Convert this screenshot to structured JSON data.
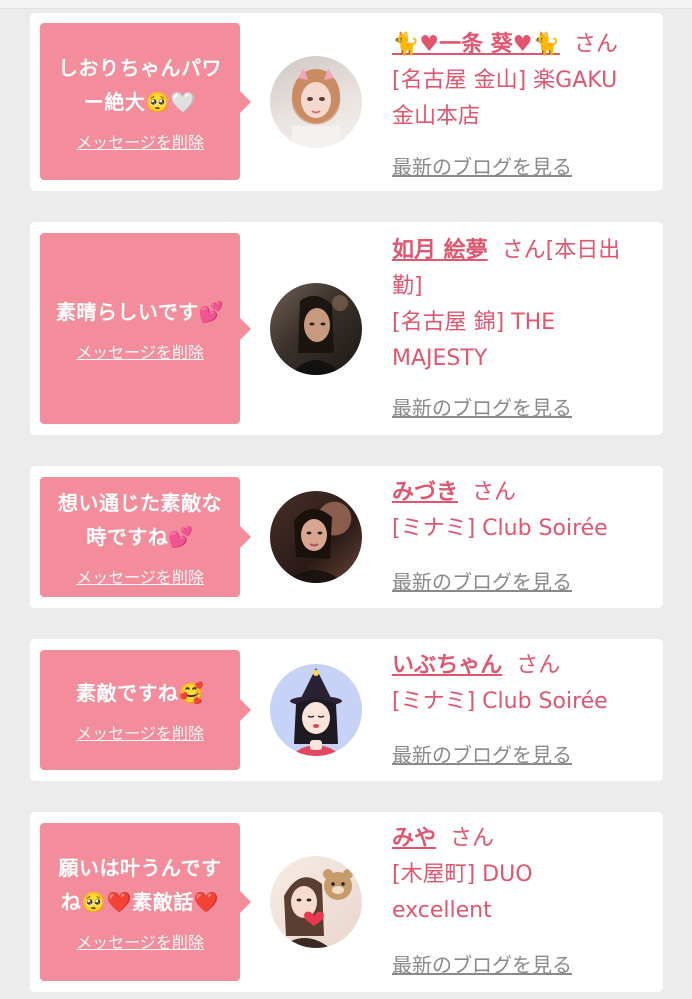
{
  "entries": [
    {
      "message_line1": "しおりちゃんパワ",
      "message_line2": "ー絶大🥺🤍",
      "delete_label": "メッセージを削除",
      "name": "🐈♥︎一条 葵♥︎🐈",
      "suffix": "さん",
      "shop_line1": "[名古屋 金山] 楽GAKU",
      "shop_line2": "金山本店",
      "blog_label": "最新のブログを見る"
    },
    {
      "message_line1": "素晴らしいです💕",
      "delete_label": "メッセージを削除",
      "name": "如月 絵夢",
      "suffix": "さん[本日出",
      "suffix_line2": "勤]",
      "shop_line1": "[名古屋 錦] THE",
      "shop_line2": "MAJESTY",
      "blog_label": "最新のブログを見る"
    },
    {
      "message_line1": "想い通じた素敵な",
      "message_line2": "時ですね💕",
      "delete_label": "メッセージを削除",
      "name": "みづき",
      "suffix": "さん",
      "shop_line1": "[ミナミ] Club Soirée",
      "blog_label": "最新のブログを見る"
    },
    {
      "message_line1": "素敵ですね🥰",
      "delete_label": "メッセージを削除",
      "name": "いぶちゃん",
      "suffix": "さん",
      "shop_line1": "[ミナミ] Club Soirée",
      "blog_label": "最新のブログを見る"
    },
    {
      "message_line1": "願いは叶うんです",
      "message_line2": "ね🥺❤️素敵話❤️",
      "delete_label": "メッセージを削除",
      "name": "みや",
      "suffix": "さん",
      "shop_line1": "[木屋町] DUO",
      "shop_line2": "excellent",
      "blog_label": "最新のブログを見る"
    }
  ]
}
